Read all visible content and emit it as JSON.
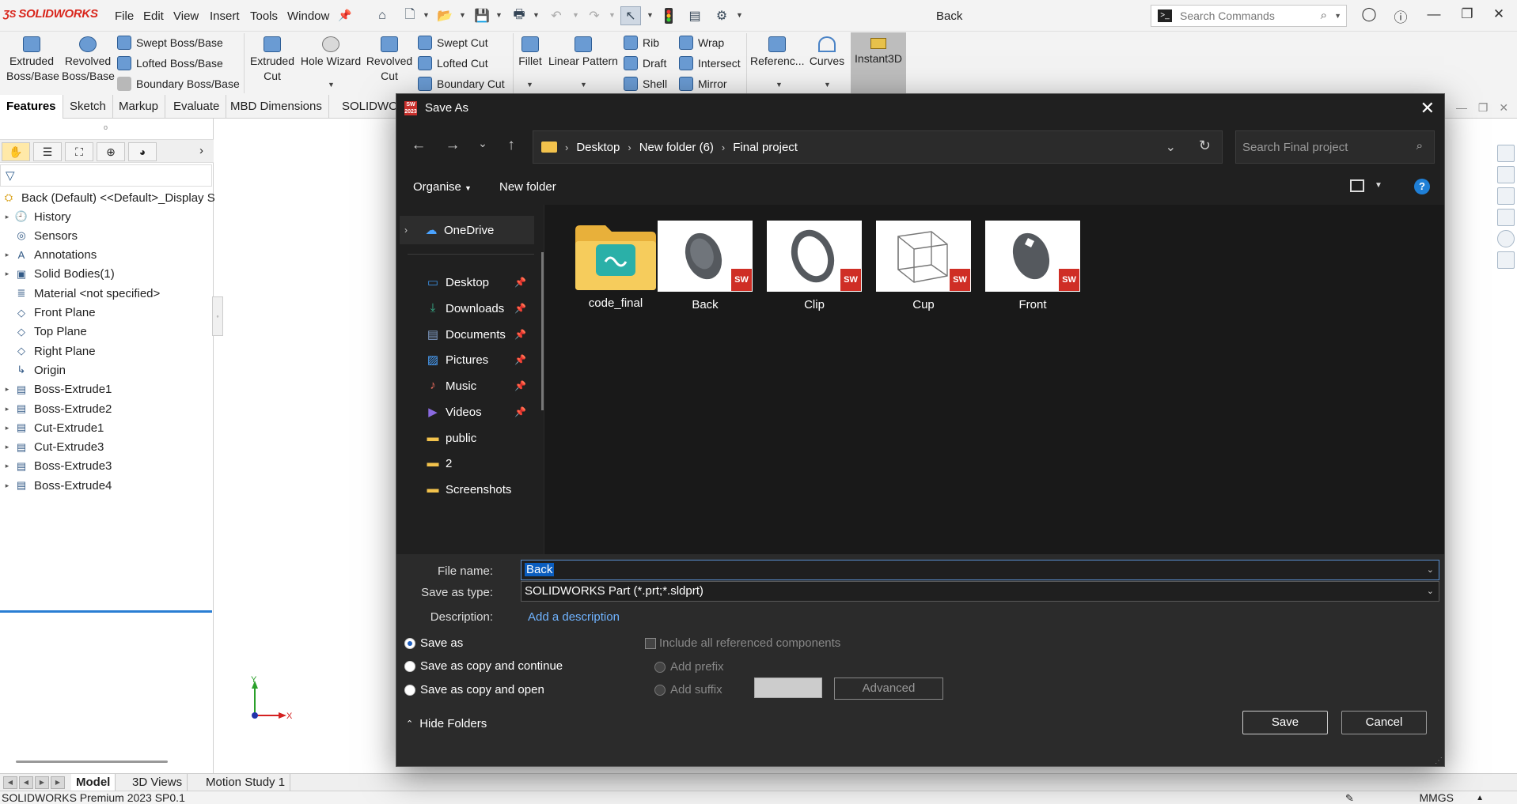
{
  "app": {
    "brand": "SOLIDWORKS",
    "document_title": "Back",
    "menus": [
      "File",
      "Edit",
      "View",
      "Insert",
      "Tools",
      "Window"
    ],
    "search_placeholder": "Search Commands"
  },
  "ribbon": {
    "extruded_boss": "Extruded Boss/Base",
    "revolved_boss": "Revolved Boss/Base",
    "swept_boss": "Swept Boss/Base",
    "lofted_boss": "Lofted Boss/Base",
    "boundary_boss": "Boundary Boss/Base",
    "extruded_cut": "Extruded Cut",
    "hole_wizard": "Hole Wizard",
    "revolved_cut": "Revolved Cut",
    "swept_cut": "Swept Cut",
    "lofted_cut": "Lofted Cut",
    "boundary_cut": "Boundary Cut",
    "fillet": "Fillet",
    "linear_pattern": "Linear Pattern",
    "rib": "Rib",
    "draft": "Draft",
    "shell": "Shell",
    "wrap": "Wrap",
    "intersect": "Intersect",
    "mirror": "Mirror",
    "reference": "Referenc...",
    "curves": "Curves",
    "instant3d": "Instant3D"
  },
  "command_tabs": [
    "Features",
    "Sketch",
    "Markup",
    "Evaluate",
    "MBD Dimensions",
    "SOLIDWO"
  ],
  "tree": {
    "root": "Back (Default) <<Default>_Display S",
    "items": [
      {
        "label": "History",
        "expandable": true
      },
      {
        "label": "Sensors",
        "expandable": false
      },
      {
        "label": "Annotations",
        "expandable": true
      },
      {
        "label": "Solid Bodies(1)",
        "expandable": true
      },
      {
        "label": "Material <not specified>",
        "expandable": false
      },
      {
        "label": "Front Plane",
        "expandable": false
      },
      {
        "label": "Top Plane",
        "expandable": false
      },
      {
        "label": "Right Plane",
        "expandable": false
      },
      {
        "label": "Origin",
        "expandable": false
      },
      {
        "label": "Boss-Extrude1",
        "expandable": true
      },
      {
        "label": "Boss-Extrude2",
        "expandable": true
      },
      {
        "label": "Cut-Extrude1",
        "expandable": true
      },
      {
        "label": "Cut-Extrude3",
        "expandable": true
      },
      {
        "label": "Boss-Extrude3",
        "expandable": true
      },
      {
        "label": "Boss-Extrude4",
        "expandable": true
      }
    ]
  },
  "bottom_tabs": [
    "Model",
    "3D Views",
    "Motion Study 1"
  ],
  "status": {
    "product": "SOLIDWORKS Premium 2023 SP0.1",
    "units": "MMGS"
  },
  "triad": {
    "y": "Y",
    "x": "X"
  },
  "dialog": {
    "title": "Save As",
    "breadcrumb": [
      "Desktop",
      "New folder (6)",
      "Final project"
    ],
    "search_placeholder": "Search Final project",
    "organise": "Organise",
    "new_folder": "New folder",
    "help": "?",
    "nav": [
      {
        "label": "OneDrive",
        "icon": "cloud-icon",
        "pinned": false
      },
      {
        "label": "Desktop",
        "icon": "desktop-icon",
        "pinned": true
      },
      {
        "label": "Downloads",
        "icon": "download-icon",
        "pinned": true
      },
      {
        "label": "Documents",
        "icon": "document-icon",
        "pinned": true
      },
      {
        "label": "Pictures",
        "icon": "picture-icon",
        "pinned": true
      },
      {
        "label": "Music",
        "icon": "music-icon",
        "pinned": true
      },
      {
        "label": "Videos",
        "icon": "video-icon",
        "pinned": true
      },
      {
        "label": "public",
        "icon": "folder-icon",
        "pinned": false
      },
      {
        "label": "2",
        "icon": "folder-icon",
        "pinned": false
      },
      {
        "label": "Screenshots",
        "icon": "folder-icon",
        "pinned": false
      }
    ],
    "files": [
      {
        "name": "code_final",
        "type": "folder"
      },
      {
        "name": "Back",
        "type": "part"
      },
      {
        "name": "Clip",
        "type": "part"
      },
      {
        "name": "Cup",
        "type": "part"
      },
      {
        "name": "Front",
        "type": "part"
      }
    ],
    "sw_badge": "SW",
    "file_name_label": "File name:",
    "file_name_value": "Back",
    "save_type_label": "Save as type:",
    "save_type_value": "SOLIDWORKS Part (*.prt;*.sldprt)",
    "description_label": "Description:",
    "description_link": "Add a description",
    "options": {
      "save_as": "Save as",
      "save_copy_continue": "Save as copy and continue",
      "save_copy_open": "Save as copy and open",
      "selected": "save_as"
    },
    "include_refs": "Include all referenced components",
    "add_prefix": "Add prefix",
    "add_suffix": "Add suffix",
    "advanced": "Advanced",
    "save": "Save",
    "cancel": "Cancel",
    "hide_folders": "Hide Folders"
  }
}
